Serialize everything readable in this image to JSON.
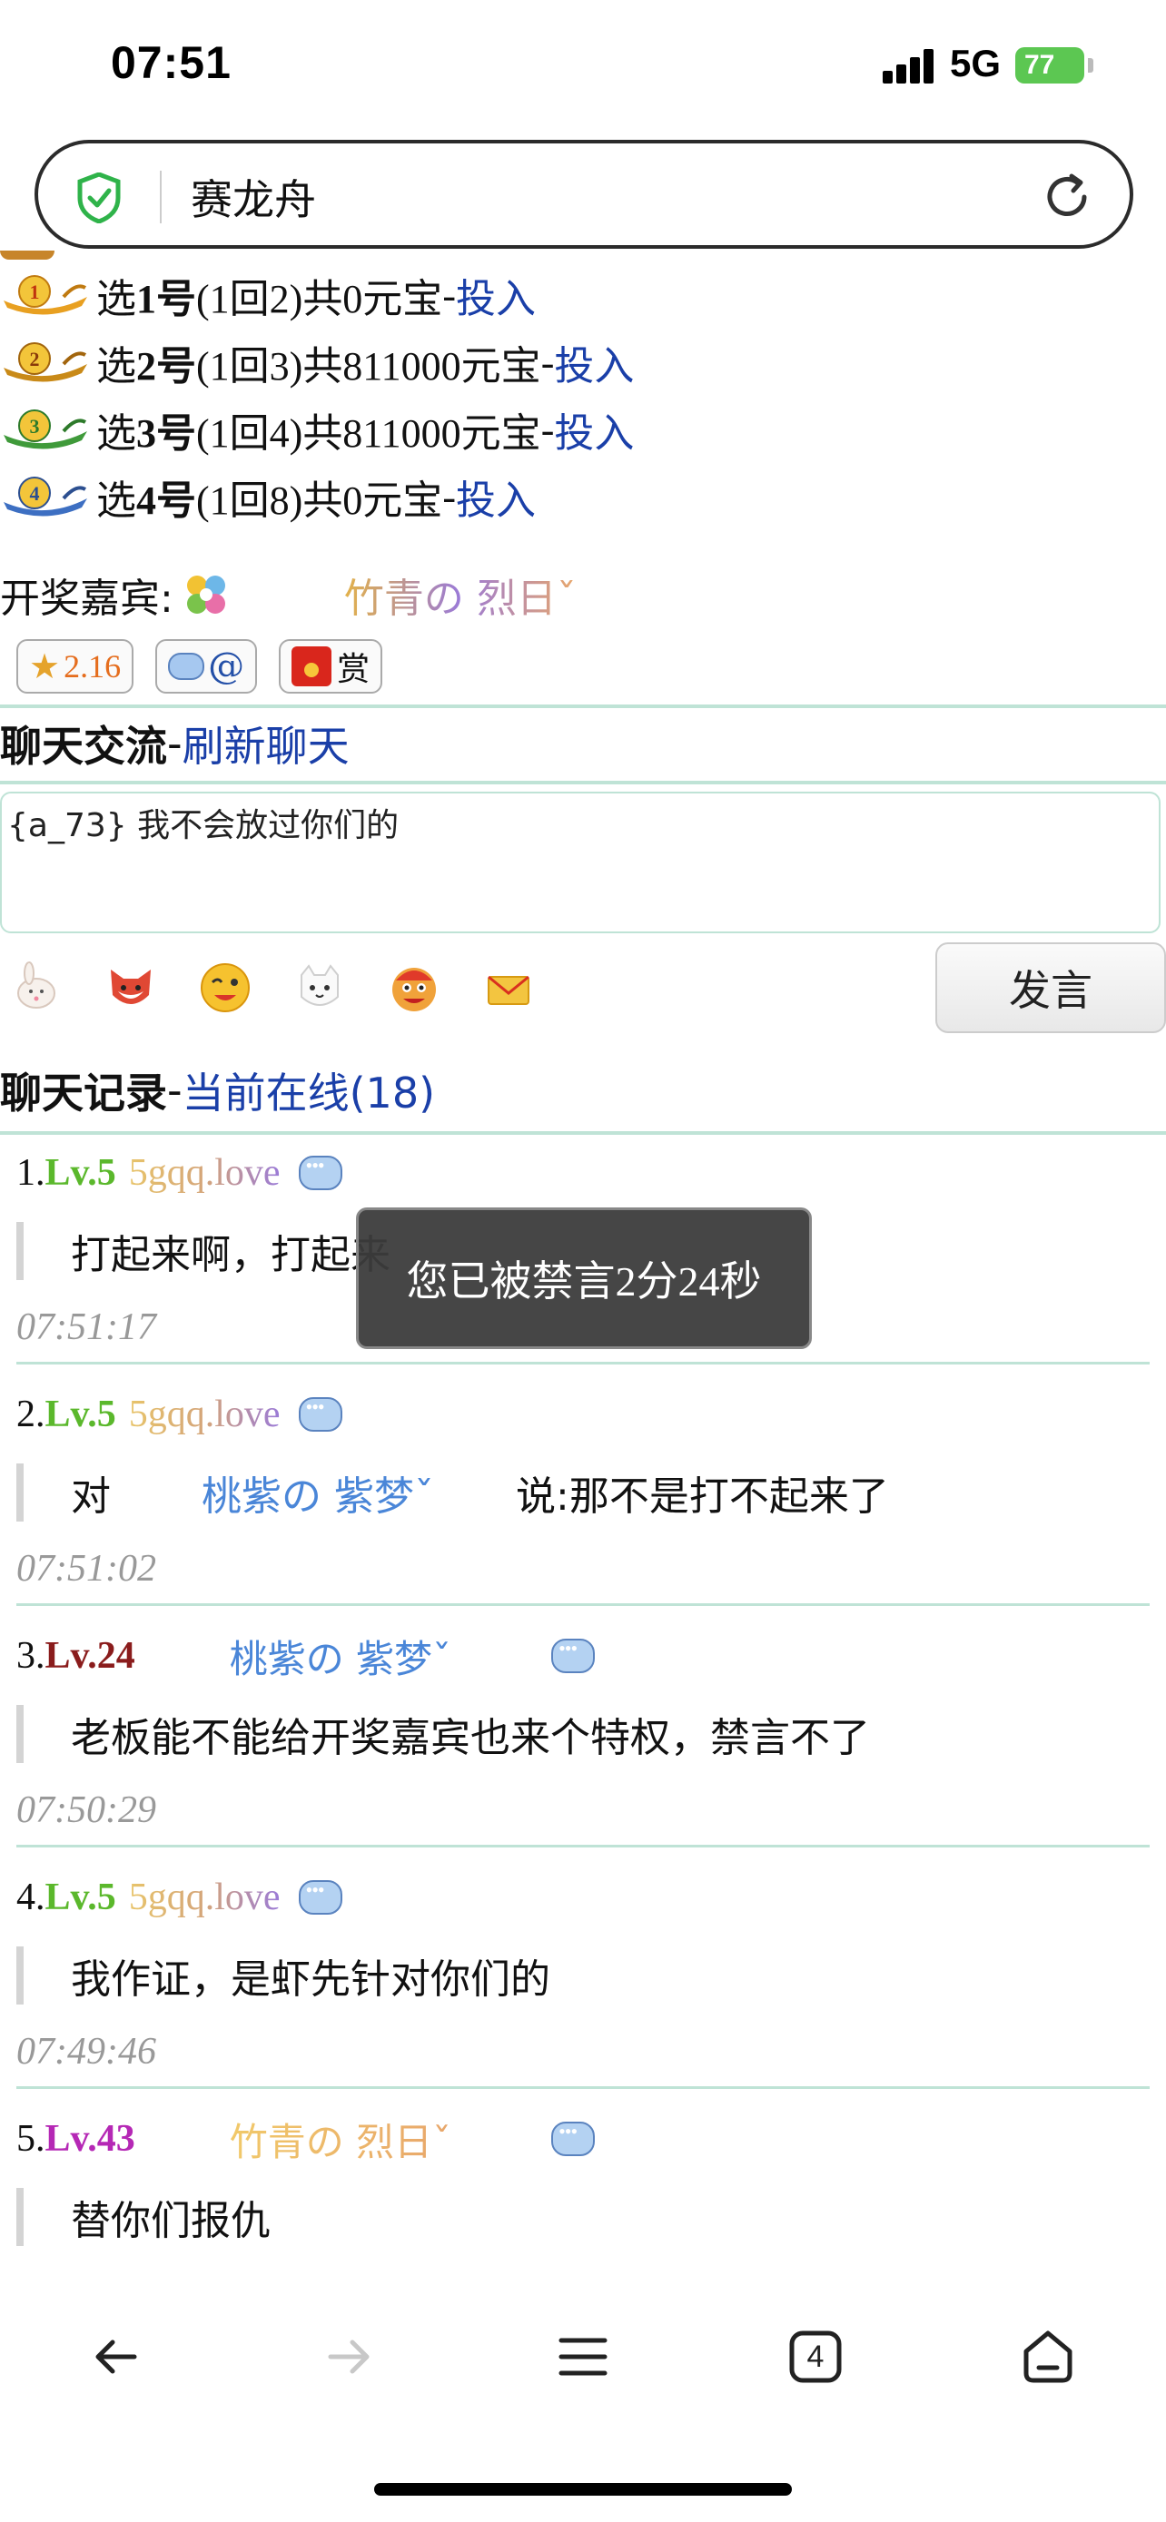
{
  "status_bar": {
    "time": "07:51",
    "network": "5G",
    "battery": "77"
  },
  "address_bar": {
    "text": "赛龙舟"
  },
  "boats": [
    {
      "badge": "1",
      "pick_prefix": "选",
      "number": "1号",
      "odds": "(1回2)",
      "total": "共0元宝",
      "sep": "-",
      "action": "投入",
      "color": "#e8a021"
    },
    {
      "badge": "2",
      "pick_prefix": "选",
      "number": "2号",
      "odds": "(1回3)",
      "total": "共811000元宝",
      "sep": "-",
      "action": "投入",
      "color": "#c98a18"
    },
    {
      "badge": "3",
      "pick_prefix": "选",
      "number": "3号",
      "odds": "(1回4)",
      "total": "共811000元宝",
      "sep": "-",
      "action": "投入",
      "color": "#3f9a3a"
    },
    {
      "badge": "4",
      "pick_prefix": "选",
      "number": "4号",
      "odds": "(1回8)",
      "total": "共0元宝",
      "sep": "-",
      "action": "投入",
      "color": "#3d6fc2"
    }
  ],
  "host": {
    "label": "开奖嘉宾:",
    "name": "竹青の 烈日ˇ"
  },
  "badges": {
    "score": "2.16",
    "at": "@",
    "reward": "赏"
  },
  "chat_section": {
    "title": "聊天交流",
    "sep": "-",
    "refresh": "刷新聊天"
  },
  "chat_input": {
    "value": "{a_73} 我不会放过你们的"
  },
  "send_button": {
    "label": "发言"
  },
  "records_section": {
    "title": "聊天记录",
    "sep": "-",
    "online": "当前在线(18)"
  },
  "messages": [
    {
      "index": "1.",
      "level": "Lv.5",
      "level_color": "#5bb82c",
      "user": "5gqq.love",
      "body": "打起来啊，打起来",
      "time": "07:51:17"
    },
    {
      "index": "2.",
      "level": "Lv.5",
      "level_color": "#5bb82c",
      "user": "5gqq.love",
      "body_prefix": "对",
      "body_name": "桃紫の 紫梦ˇ",
      "body_suffix": "说:那不是打不起来了",
      "time": "07:51:02"
    },
    {
      "index": "3.",
      "level": "Lv.24",
      "level_color": "#8a1c1c",
      "user": "桃紫の 紫梦ˇ",
      "body": "老板能不能给开奖嘉宾也来个特权，禁言不了",
      "time": "07:50:29"
    },
    {
      "index": "4.",
      "level": "Lv.5",
      "level_color": "#5bb82c",
      "user": "5gqq.love",
      "body": "我作证，是虾先针对你们的",
      "time": "07:49:46"
    },
    {
      "index": "5.",
      "level": "Lv.43",
      "level_color": "#b528b5",
      "user": "竹青の 烈日ˇ",
      "body": "替你们报仇"
    }
  ],
  "toast": {
    "text": "您已被禁言2分24秒"
  },
  "toolbar": {
    "tabs_count": "4"
  }
}
